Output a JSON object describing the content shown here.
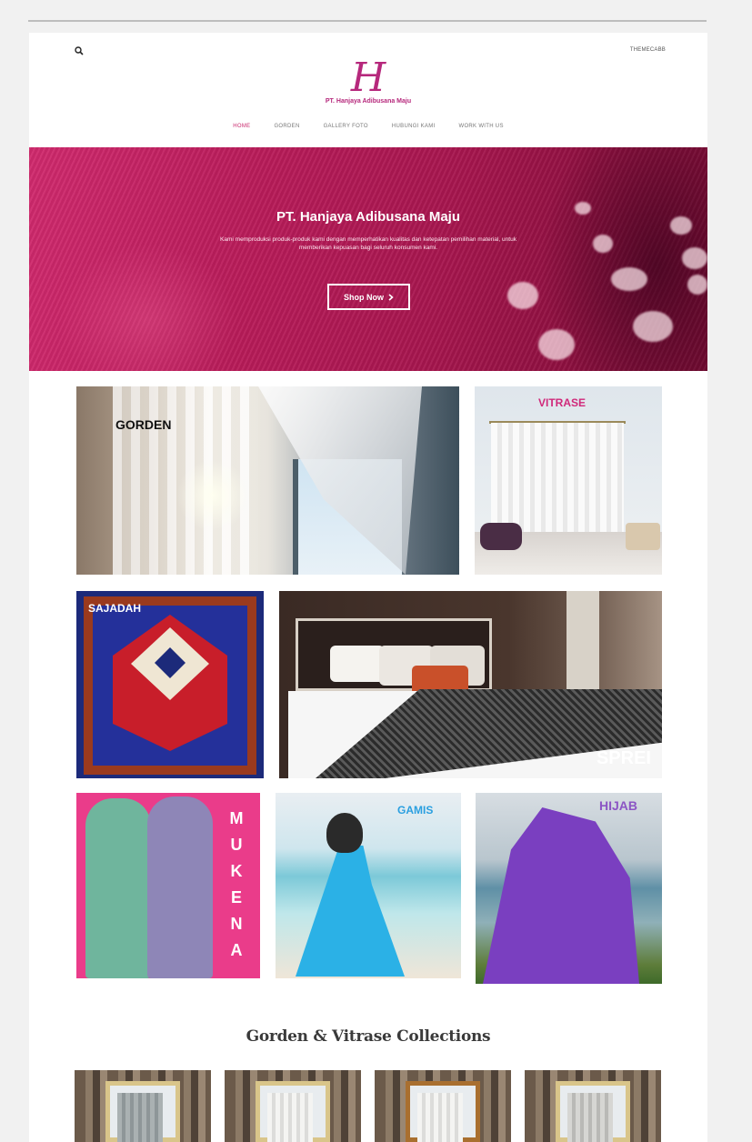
{
  "header": {
    "top_right_link": "THEMECABB",
    "logo_mark": "H",
    "logo_text": "PT. Hanjaya Adibusana Maju"
  },
  "nav": {
    "items": [
      {
        "label": "HOME",
        "active": true
      },
      {
        "label": "GORDEN",
        "active": false
      },
      {
        "label": "GALLERY FOTO",
        "active": false
      },
      {
        "label": "HUBUNGI KAMI",
        "active": false
      },
      {
        "label": "WORK WITH US",
        "active": false
      }
    ]
  },
  "hero": {
    "title": "PT. Hanjaya Adibusana Maju",
    "subtitle": "Kami memproduksi produk-produk kami dengan memperhatikan kualitas dan ketepatan pemilihan material, untuk memberikan kepuasan bagi seluruh konsumen kami.",
    "button_label": "Shop Now",
    "button_icon": "chevron-right-icon",
    "colors": {
      "primary": "#b81b59",
      "accent": "#c9286d"
    }
  },
  "categories": {
    "gorden": "GORDEN",
    "vitrase": "VITRASE",
    "sajadah": "SAJADAH",
    "sprei": "SPREI",
    "mukena": [
      "M",
      "U",
      "K",
      "E",
      "N",
      "A"
    ],
    "gamis": "GAMIS",
    "hijab": "HIJAB"
  },
  "collections": {
    "title": "Gorden & Vitrase Collections"
  }
}
